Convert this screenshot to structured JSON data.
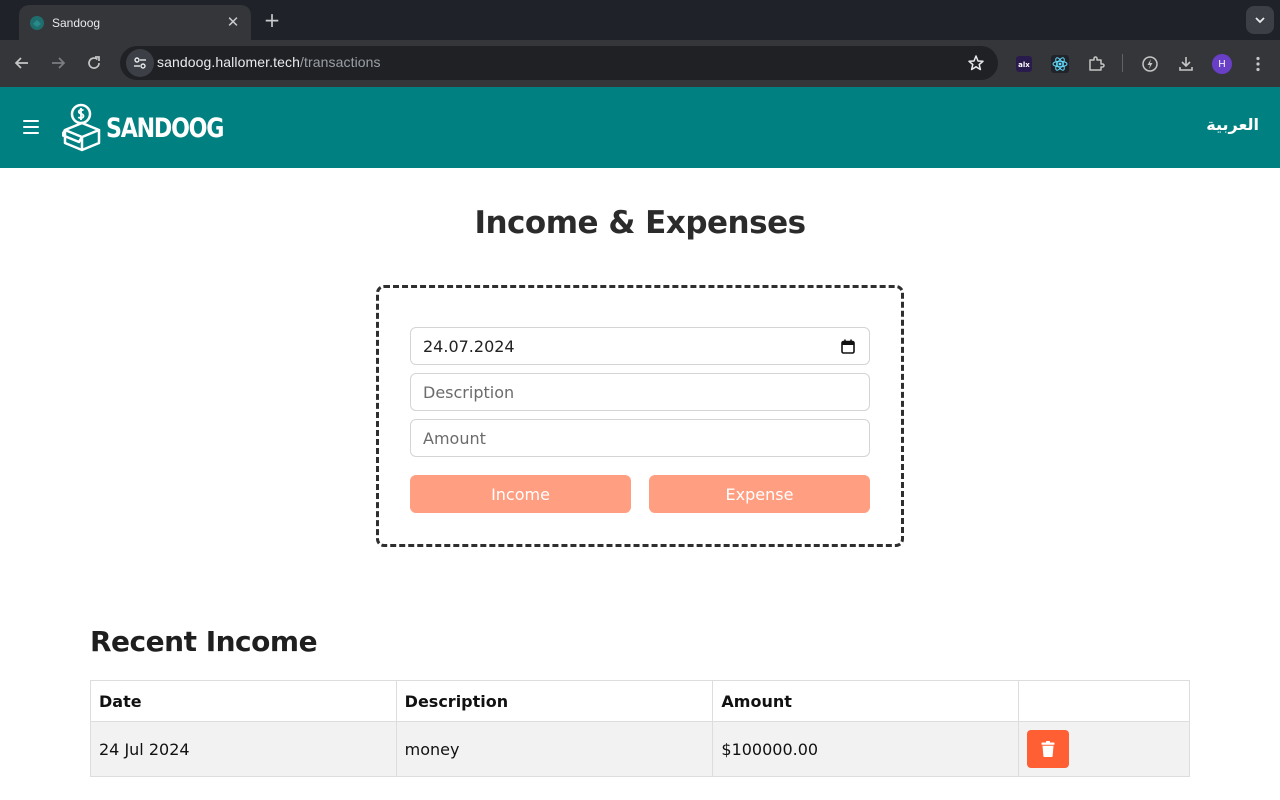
{
  "browser": {
    "tab_title": "Sandoog",
    "url_host": "sandoog.hallomer.tech",
    "url_path": "/transactions",
    "profile_initial": "H"
  },
  "header": {
    "brand": "SANDOOG",
    "language_toggle": "العربية",
    "color": "#008080"
  },
  "main": {
    "title": "Income & Expenses",
    "form": {
      "date_value": "24.07.2024",
      "description_placeholder": "Description",
      "amount_placeholder": "Amount",
      "income_button": "Income",
      "expense_button": "Expense",
      "button_color": "#ff9e80"
    },
    "recent_income": {
      "title": "Recent Income",
      "columns": [
        "Date",
        "Description",
        "Amount"
      ],
      "rows": [
        {
          "date": "24 Jul 2024",
          "description": "money",
          "amount": "$100000.00"
        }
      ],
      "delete_color": "#ff5f32"
    }
  }
}
